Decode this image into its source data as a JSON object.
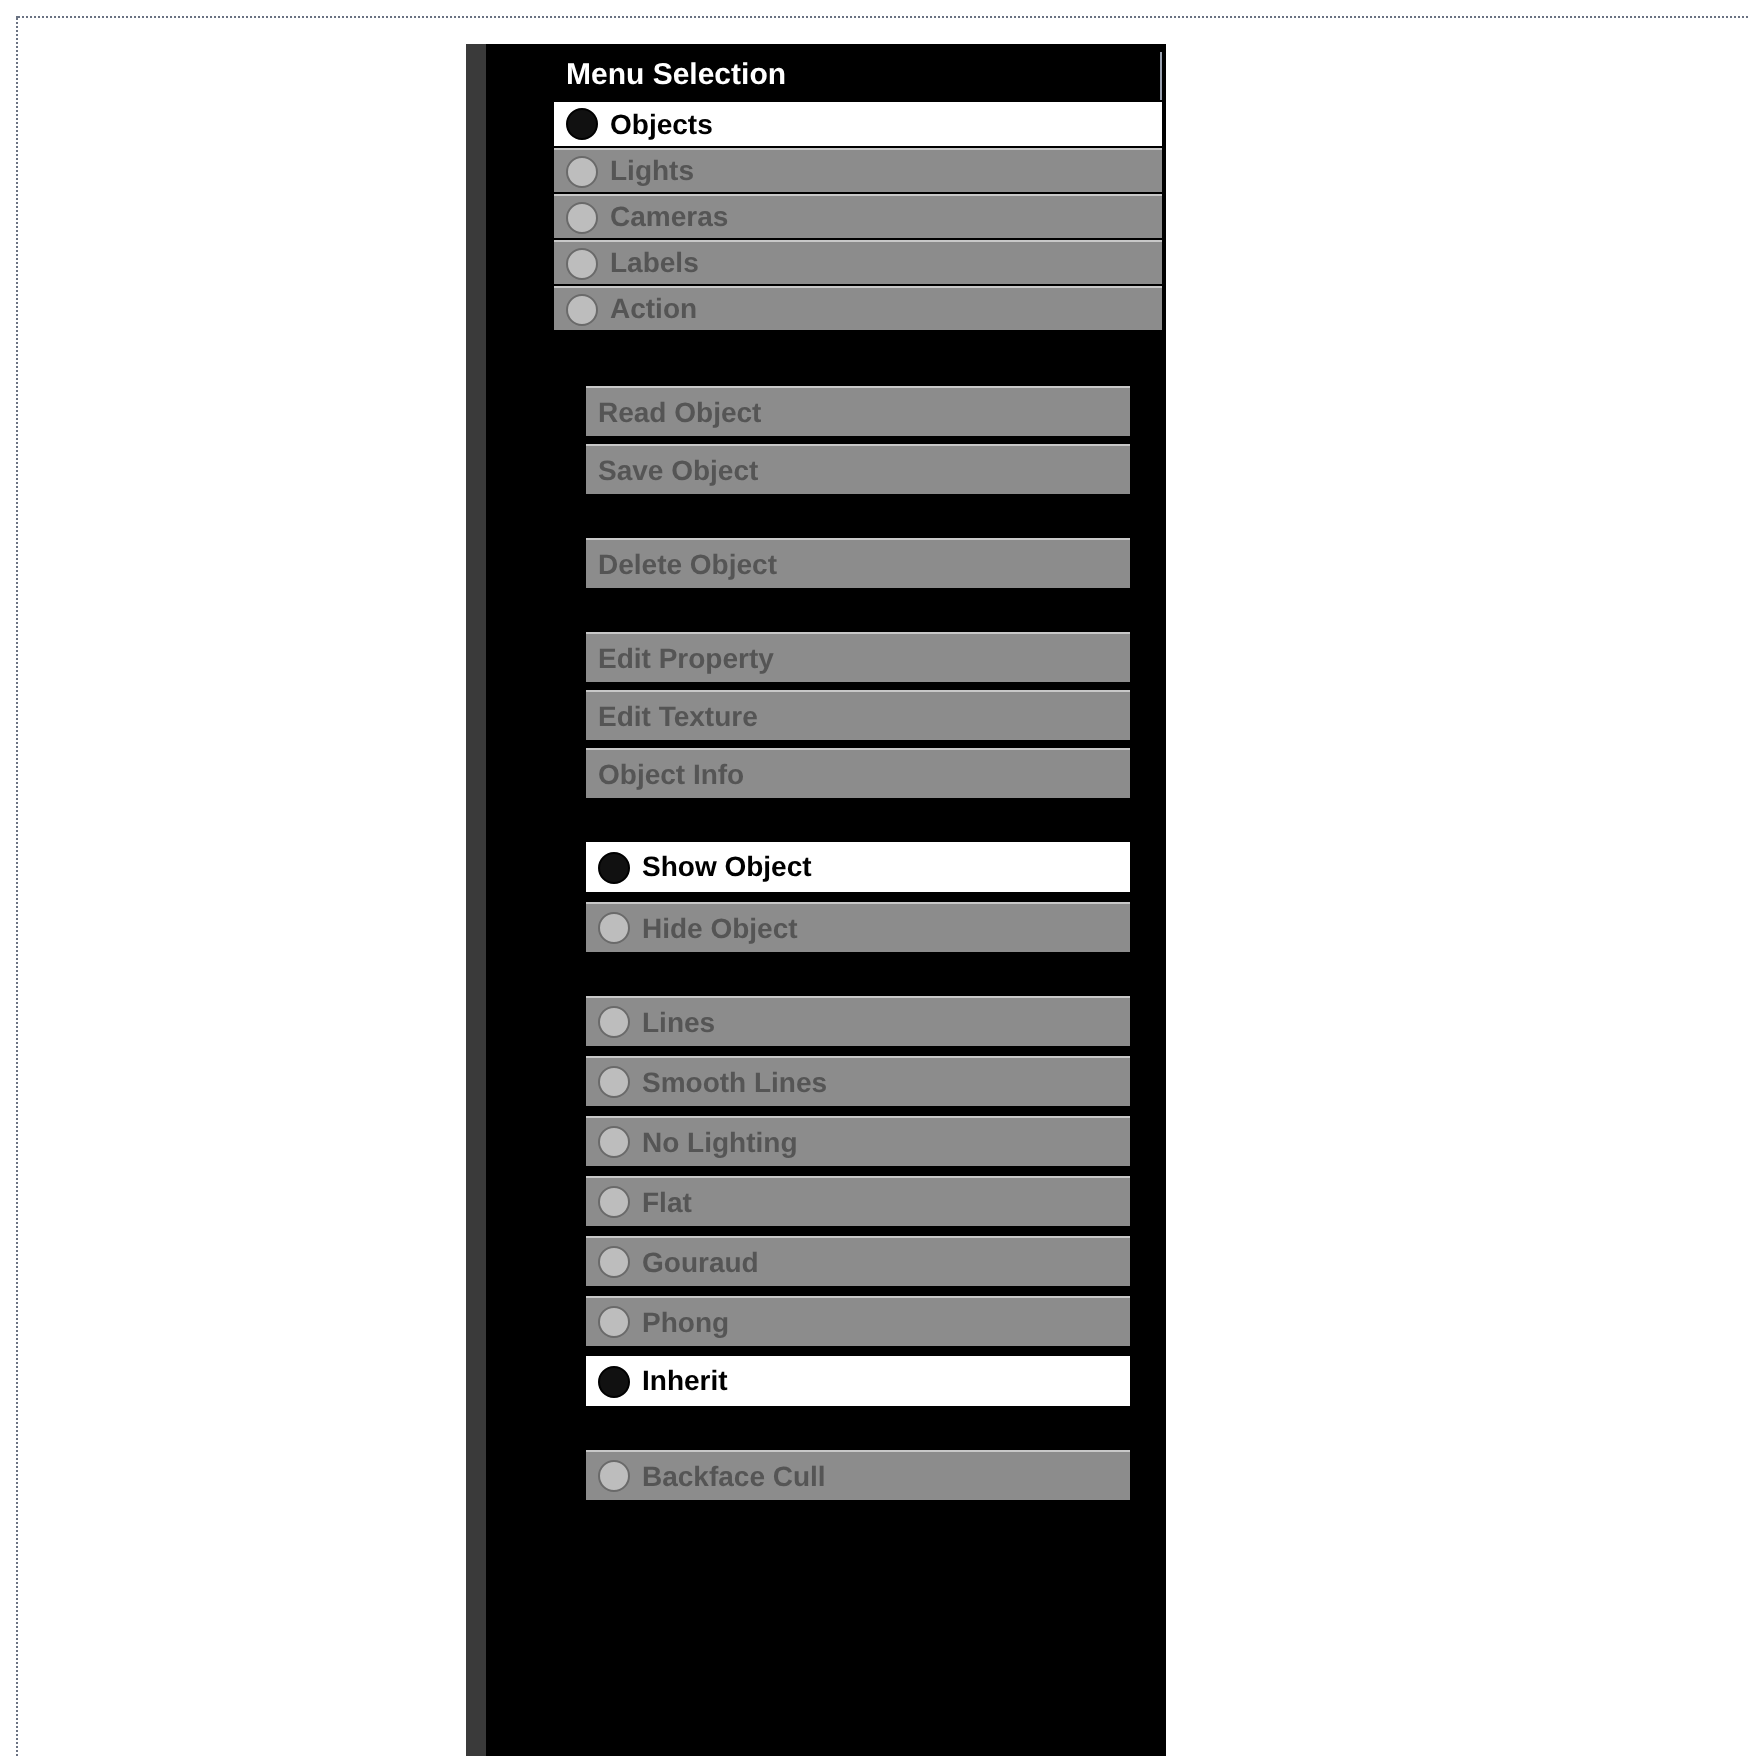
{
  "menu": {
    "title": "Menu Selection",
    "groups": [
      {
        "kind": "category",
        "items": [
          {
            "label": "Objects",
            "selected": true
          },
          {
            "label": "Lights",
            "selected": false
          },
          {
            "label": "Cameras",
            "selected": false
          },
          {
            "label": "Labels",
            "selected": false
          },
          {
            "label": "Action",
            "selected": false
          }
        ]
      },
      {
        "kind": "action",
        "items": [
          {
            "label": "Read Object"
          },
          {
            "label": "Save Object"
          }
        ]
      },
      {
        "kind": "action",
        "items": [
          {
            "label": "Delete Object"
          }
        ]
      },
      {
        "kind": "action",
        "items": [
          {
            "label": "Edit Property"
          },
          {
            "label": "Edit Texture"
          },
          {
            "label": "Object Info"
          }
        ]
      },
      {
        "kind": "option",
        "items": [
          {
            "label": "Show Object",
            "selected": true
          },
          {
            "label": "Hide Object",
            "selected": false
          }
        ]
      },
      {
        "kind": "option",
        "items": [
          {
            "label": "Lines",
            "selected": false
          },
          {
            "label": "Smooth Lines",
            "selected": false
          },
          {
            "label": "No Lighting",
            "selected": false
          },
          {
            "label": "Flat",
            "selected": false
          },
          {
            "label": "Gouraud",
            "selected": false
          },
          {
            "label": "Phong",
            "selected": false
          },
          {
            "label": "Inherit",
            "selected": true
          }
        ]
      },
      {
        "kind": "option",
        "items": [
          {
            "label": "Backface Cull",
            "selected": false
          }
        ]
      }
    ]
  }
}
